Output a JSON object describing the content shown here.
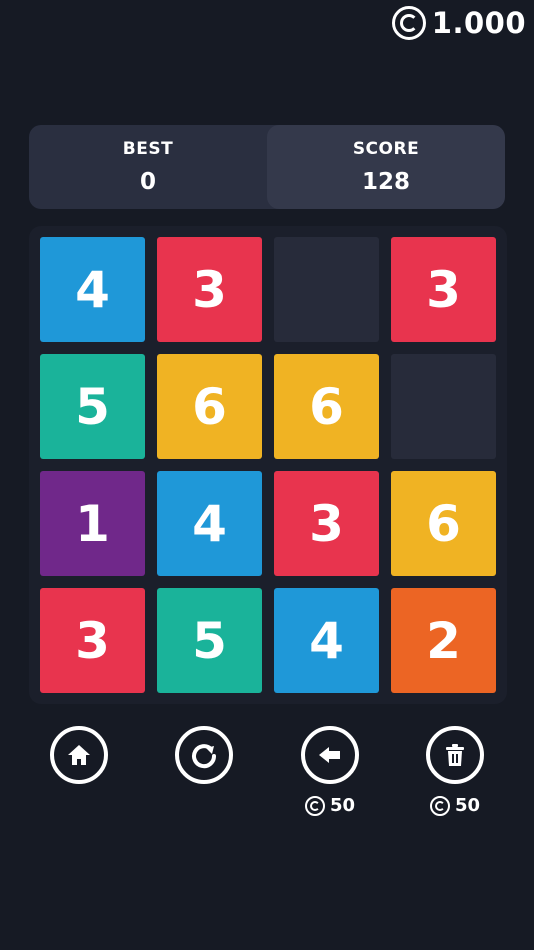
{
  "coins": {
    "balance": "1.000",
    "icon": "coin-icon"
  },
  "scoreboard": {
    "best_label": "BEST",
    "best_value": "0",
    "score_label": "SCORE",
    "score_value": "128"
  },
  "board": {
    "rows": [
      [
        {
          "value": "4",
          "color": "#1f98d8"
        },
        {
          "value": "3",
          "color": "#e8344e"
        },
        {
          "value": "",
          "color": ""
        },
        {
          "value": "3",
          "color": "#e8344e"
        }
      ],
      [
        {
          "value": "5",
          "color": "#1ab39a"
        },
        {
          "value": "6",
          "color": "#f0b323"
        },
        {
          "value": "6",
          "color": "#f0b323"
        },
        {
          "value": "",
          "color": ""
        }
      ],
      [
        {
          "value": "1",
          "color": "#70288a"
        },
        {
          "value": "4",
          "color": "#1f98d8"
        },
        {
          "value": "3",
          "color": "#e8344e"
        },
        {
          "value": "6",
          "color": "#f0b323"
        }
      ],
      [
        {
          "value": "3",
          "color": "#e8344e"
        },
        {
          "value": "5",
          "color": "#1ab39a"
        },
        {
          "value": "4",
          "color": "#1f98d8"
        },
        {
          "value": "2",
          "color": "#ec6524"
        }
      ]
    ]
  },
  "controls": {
    "home": {
      "icon": "home-icon"
    },
    "restart": {
      "icon": "restart-icon"
    },
    "undo": {
      "icon": "undo-arrow-icon",
      "cost": "50"
    },
    "delete": {
      "icon": "trash-icon",
      "cost": "50"
    }
  }
}
